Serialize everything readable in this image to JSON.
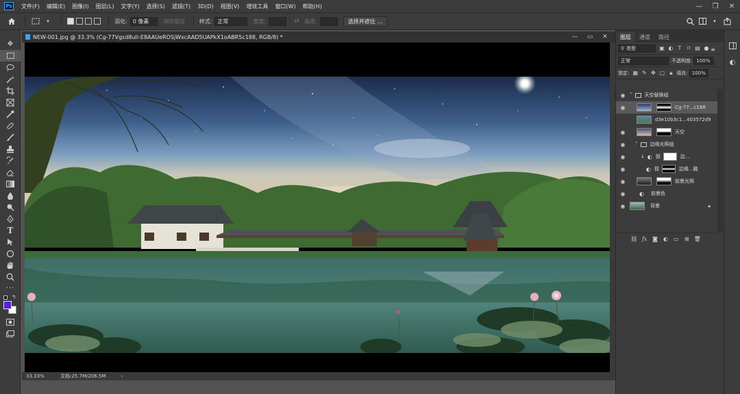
{
  "menu": {
    "logo": "Ps",
    "items": [
      "文件(F)",
      "编辑(E)",
      "图像(I)",
      "图层(L)",
      "文字(Y)",
      "选择(S)",
      "滤镜(T)",
      "3D(D)",
      "视图(V)",
      "增效工具",
      "窗口(W)",
      "帮助(H)"
    ]
  },
  "options": {
    "feather_label": "羽化:",
    "feather_value": "0 像素",
    "antialias_label": "消除锯齿",
    "style_label": "样式:",
    "style_value": "正常",
    "width_label": "宽度:",
    "height_label": "高度:",
    "select_mask_label": "选择并遮住 ..."
  },
  "document": {
    "title": "NEW-001.jpg @ 33.3% (Cg-77Vgsd8ull-E8AAUeROSjWxcAAD5UAPkX1oABR5c188, RGB/8) *",
    "zoom": "33.33%",
    "doc_info": "文档:25.7M/206.5M"
  },
  "panels": {
    "tabs": [
      "图层",
      "通道",
      "路径"
    ],
    "filter_kind": "类型",
    "blend_mode": "正常",
    "opacity_label": "不透明度:",
    "opacity_value": "100%",
    "lock_label": "锁定:",
    "fill_label": "填充:",
    "fill_value": "100%"
  },
  "layers": [
    {
      "name": "天空替换组"
    },
    {
      "name": "Cg-77...c188"
    },
    {
      "name": "d3e10b3c1...403572d9"
    },
    {
      "name": "天空"
    },
    {
      "name": "边缘光照组"
    },
    {
      "name": "边..."
    },
    {
      "name": "边缘...融"
    },
    {
      "name": "前景光照"
    },
    {
      "name": "前景色"
    },
    {
      "name": "背景"
    }
  ],
  "colors": {
    "foreground": "#5a1ee0",
    "background": "#ffffff",
    "ui_dark": "#3c3c3c",
    "accent": "#31a8ff"
  }
}
